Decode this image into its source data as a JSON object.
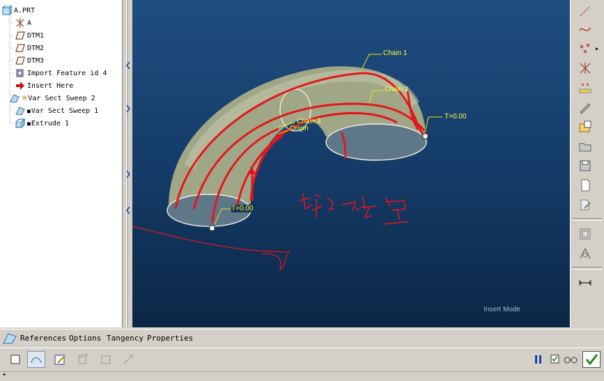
{
  "model_tree": {
    "items": [
      {
        "label": "A.PRT"
      },
      {
        "label": "A"
      },
      {
        "label": "DTM1"
      },
      {
        "label": "DTM2"
      },
      {
        "label": "DTM3"
      },
      {
        "label": "Import Feature id 4"
      },
      {
        "label": "Insert Here"
      },
      {
        "label": "Var Sect Sweep 2"
      },
      {
        "label": "Var Sect Sweep 1"
      },
      {
        "label": "Extrude 1"
      }
    ]
  },
  "viewport": {
    "chain_labels": [
      "Chain 1",
      "Chain 2",
      "Chain 3"
    ],
    "origin_label": "Origin",
    "t_labels": [
      "T=0.00",
      "T=0.00"
    ],
    "mode_text": "Insert Mode",
    "annotation_text": "两个点"
  },
  "dashboard": {
    "tabs": [
      "References",
      "Options",
      "Tangency",
      "Properties"
    ]
  },
  "colors": {
    "chain": "#e8141b",
    "viewport_top": "#1f4d80",
    "viewport_bottom": "#0b2746",
    "surface": "#9fa786",
    "callout": "#e8e800",
    "confirm": "#1a8a1a"
  },
  "icons": {
    "right_toolbar": [
      "datum-curve-icon",
      "sketch-curve-icon",
      "datum-point-icon",
      "datum-csys-icon",
      "datum-axis-icon",
      "pencil-icon",
      "folder-new-icon",
      "folder-open-icon",
      "save-icon",
      "new-file-icon",
      "edit-file-icon",
      "layer-icon",
      "measure-icon",
      "ruler-icon"
    ],
    "dashboard": [
      "solid-icon",
      "surface-icon",
      "sketch-icon",
      "remove-material-icon",
      "thicken-icon",
      "scale-icon",
      "pause-icon",
      "preview-check-icon",
      "glasses-icon",
      "confirm-icon"
    ]
  }
}
